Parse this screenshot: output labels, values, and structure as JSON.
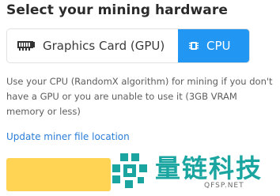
{
  "section": {
    "heading": "Select your mining hardware"
  },
  "hardware_toggle": {
    "options": [
      {
        "label": "Graphics Card (GPU)",
        "icon": "gpu-card-icon",
        "selected": false
      },
      {
        "label": "CPU",
        "icon": "cpu-chip-icon",
        "selected": true
      }
    ],
    "accent_color": "#2196f3"
  },
  "description": "Use your CPU (RandomX algorithm) for mining if you don't have a GPU or you are unable to use it (3GB VRAM memory or less)",
  "update_link": "Update miner file location",
  "action_button": {
    "color": "#ffd454"
  },
  "watermark": {
    "text": "量链科技",
    "sub": "QFSP.NET",
    "icon": "puzzle-logo-icon"
  }
}
